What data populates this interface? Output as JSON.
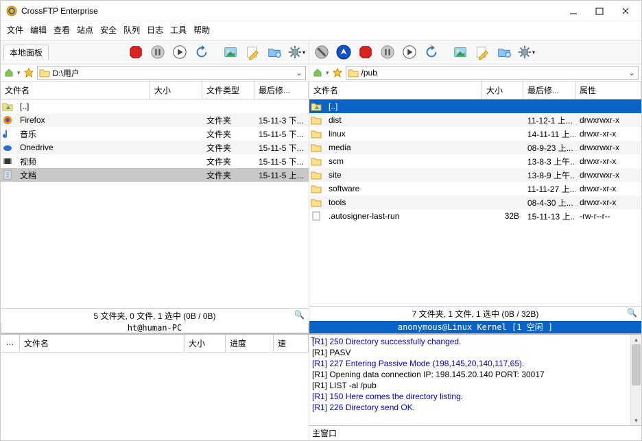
{
  "title": "CrossFTP Enterprise",
  "menu": [
    "文件",
    "编辑",
    "查看",
    "站点",
    "安全",
    "队列",
    "日志",
    "工具",
    "帮助"
  ],
  "left": {
    "tab": "本地面板",
    "path": "D:\\用户",
    "cols": {
      "name": "文件名",
      "size": "大小",
      "type": "文件类型",
      "mod": "最后修..."
    },
    "files": [
      {
        "ico": "up",
        "name": "[..]",
        "size": "",
        "type": "",
        "mod": ""
      },
      {
        "ico": "ff",
        "name": "Firefox",
        "size": "",
        "type": "文件夹",
        "mod": "15-11-3 下..."
      },
      {
        "ico": "mu",
        "name": "音乐",
        "size": "",
        "type": "文件夹",
        "mod": "15-11-5 下..."
      },
      {
        "ico": "od",
        "name": "Onedrive",
        "size": "",
        "type": "文件夹",
        "mod": "15-11-5 下..."
      },
      {
        "ico": "vi",
        "name": "视频",
        "size": "",
        "type": "文件夹",
        "mod": "15-11-5 下..."
      },
      {
        "ico": "do",
        "name": "文档",
        "size": "",
        "type": "文件夹",
        "mod": "15-11-5 上...",
        "sel": true
      }
    ],
    "status": "5 文件夹, 0 文件, 1 选中 (0B / 0B)",
    "conn": "ht@human-PC"
  },
  "right": {
    "path": "/pub",
    "cols": {
      "name": "文件名",
      "size": "大小",
      "mod": "最后修...",
      "attr": "属性"
    },
    "files": [
      {
        "ico": "up",
        "name": "[..]",
        "size": "",
        "mod": "",
        "attr": "",
        "sel": true
      },
      {
        "ico": "fd",
        "name": "dist",
        "size": "",
        "mod": "11-12-1 上...",
        "attr": "drwxrwxr-x"
      },
      {
        "ico": "fd",
        "name": "linux",
        "size": "",
        "mod": "14-11-11 上...",
        "attr": "drwxr-xr-x"
      },
      {
        "ico": "fd",
        "name": "media",
        "size": "",
        "mod": "08-9-23 上...",
        "attr": "drwxrwxr-x"
      },
      {
        "ico": "fd",
        "name": "scm",
        "size": "",
        "mod": "13-8-3 上午...",
        "attr": "drwxr-xr-x"
      },
      {
        "ico": "fd",
        "name": "site",
        "size": "",
        "mod": "13-8-9 上午...",
        "attr": "drwxrwxr-x"
      },
      {
        "ico": "fd",
        "name": "software",
        "size": "",
        "mod": "11-11-27 上...",
        "attr": "drwxr-xr-x"
      },
      {
        "ico": "fd",
        "name": "tools",
        "size": "",
        "mod": "08-4-30 上...",
        "attr": "drwxr-xr-x"
      },
      {
        "ico": "fi",
        "name": ".autosigner-last-run",
        "size": "32B",
        "mod": "15-11-13 上...",
        "attr": "-rw-r--r--"
      }
    ],
    "status": "7 文件夹, 1 文件, 1 选中 (0B / 32B)",
    "conn": "anonymous@Linux Kernel [1 空闲 ]"
  },
  "queue": {
    "cols": {
      "idx": "…",
      "name": "文件名",
      "size": "大小",
      "prog": "进度",
      "speed": "速"
    },
    "t_label": "T"
  },
  "log": {
    "lines": [
      {
        "c": "blue",
        "t": "[R1] 250 Directory successfully changed."
      },
      {
        "c": "black",
        "t": "[R1] PASV"
      },
      {
        "c": "blue",
        "t": "[R1] 227 Entering Passive Mode (198,145,20,140,117,65)."
      },
      {
        "c": "black",
        "t": "[R1] Opening data connection IP: 198.145.20.140 PORT: 30017"
      },
      {
        "c": "black",
        "t": "[R1] LIST -al /pub"
      },
      {
        "c": "blue",
        "t": "[R1] 150 Here comes the directory listing."
      },
      {
        "c": "blue",
        "t": "[R1] 226 Directory send OK."
      }
    ],
    "tab": "主窗口"
  }
}
